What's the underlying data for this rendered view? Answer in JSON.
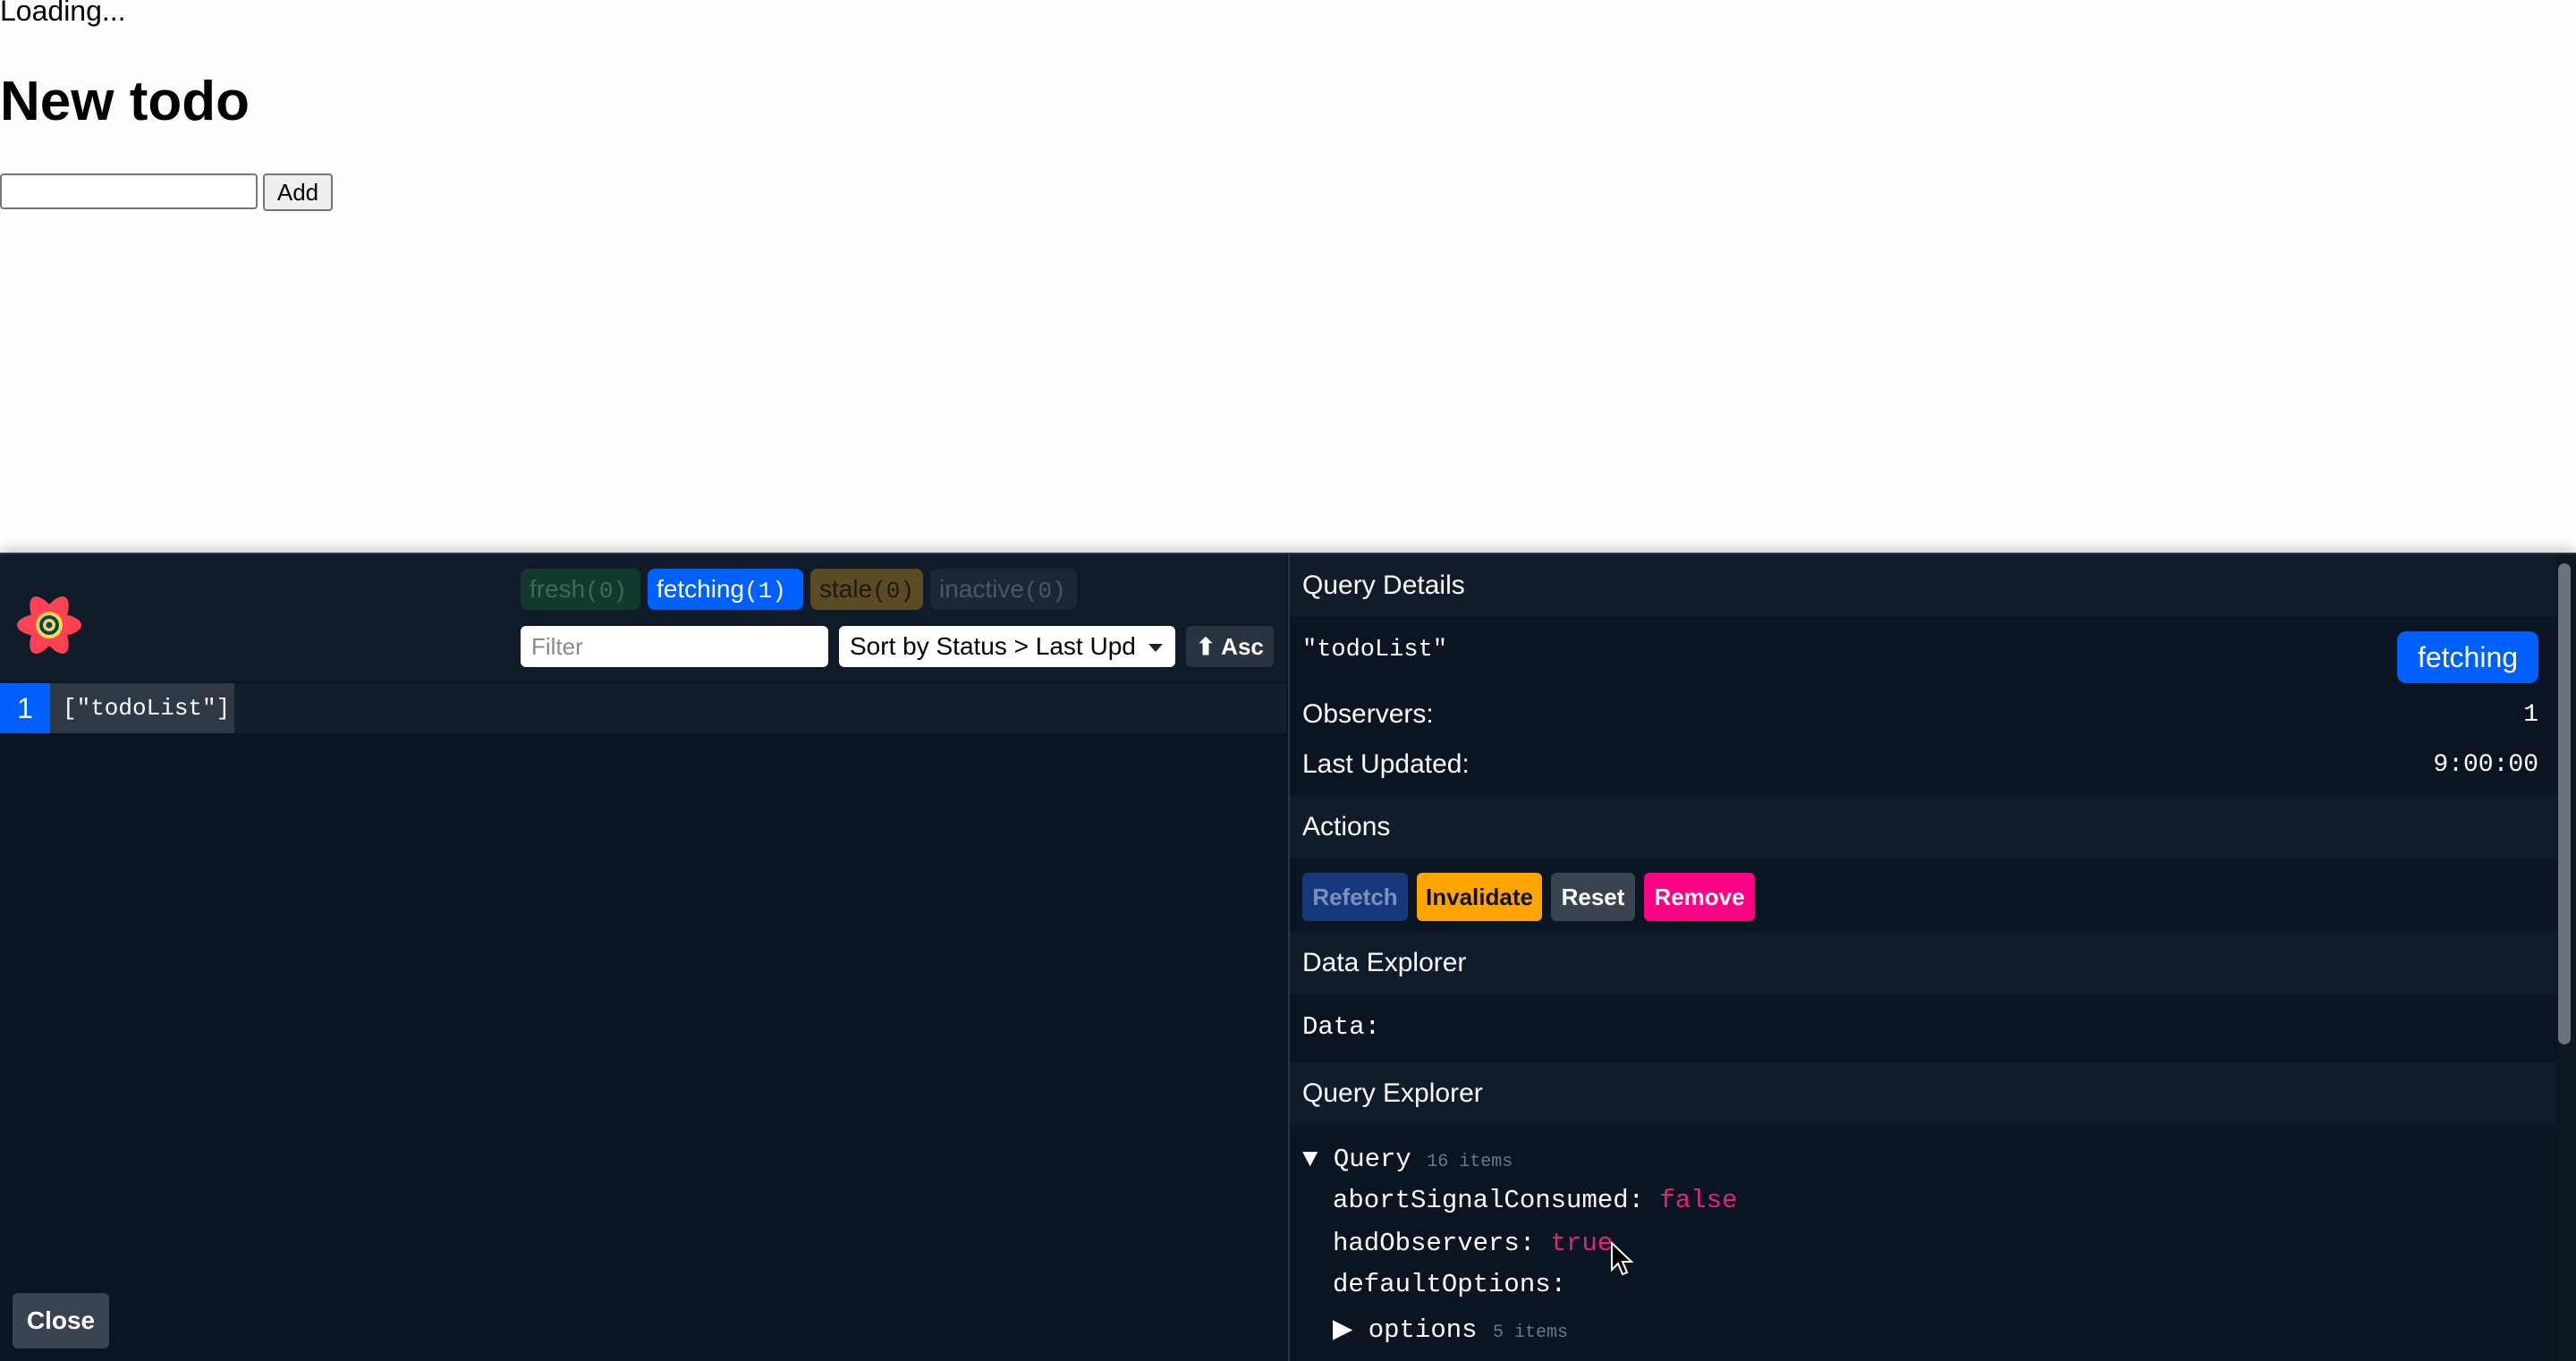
{
  "app": {
    "loading_text": "Loading...",
    "title": "New todo",
    "add_button": "Add",
    "todo_input_value": ""
  },
  "devtools": {
    "filters": [
      {
        "label": "fresh",
        "count": "(0)"
      },
      {
        "label": "fetching",
        "count": "(1)"
      },
      {
        "label": "stale",
        "count": "(0)"
      },
      {
        "label": "inactive",
        "count": "(0)"
      }
    ],
    "filter_placeholder": "Filter",
    "sort_value": "Sort by Status > Last Upd",
    "asc_label": "⬆ Asc",
    "queries": [
      {
        "observers": "1",
        "key": "[\"todoList\"]"
      }
    ],
    "close_button": "Close",
    "details": {
      "header": "Query Details",
      "query_key": "\"todoList\"",
      "status_badge": "fetching",
      "observers_label": "Observers:",
      "observers_value": "1",
      "last_updated_label": "Last Updated:",
      "last_updated_value": "9:00:00"
    },
    "actions": {
      "header": "Actions",
      "refetch": "Refetch",
      "invalidate": "Invalidate",
      "reset": "Reset",
      "remove": "Remove"
    },
    "data_explorer": {
      "header": "Data Explorer",
      "data_label": "Data:"
    },
    "query_explorer": {
      "header": "Query Explorer",
      "root_label": "Query",
      "root_count": "16 items",
      "entries": [
        {
          "key": "abortSignalConsumed:",
          "value": "false"
        },
        {
          "key": "hadObservers:",
          "value": "true"
        },
        {
          "key": "defaultOptions:",
          "value": ""
        }
      ],
      "options_label": "options",
      "options_count": "5 items"
    },
    "colors": {
      "accent_blue": "#0060ff",
      "invalidate": "#ffa500",
      "remove": "#ff0085",
      "value_pink": "#e0247b"
    }
  }
}
